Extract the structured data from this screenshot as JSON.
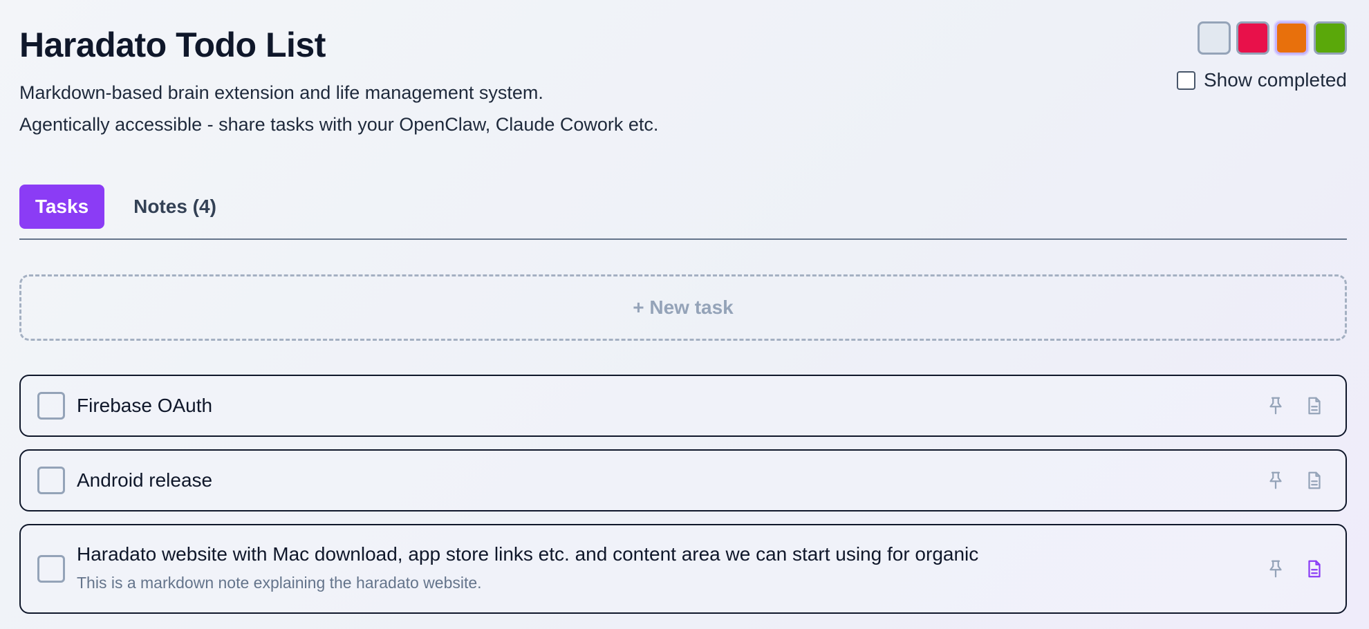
{
  "header": {
    "title": "Haradato Todo List",
    "subtitle_line1": "Markdown-based brain extension and life management system.",
    "subtitle_line2": "Agentically accessible - share tasks with your OpenClaw, Claude Cowork etc."
  },
  "theme_swatches": [
    {
      "name": "light",
      "color": "#e2e8f0",
      "active": false
    },
    {
      "name": "red",
      "color": "#e8114a",
      "active": false
    },
    {
      "name": "orange",
      "color": "#e8700c",
      "active": true
    },
    {
      "name": "green",
      "color": "#5aa80a",
      "active": false
    }
  ],
  "show_completed": {
    "label": "Show completed",
    "checked": false
  },
  "tabs": [
    {
      "label": "Tasks",
      "active": true
    },
    {
      "label": "Notes (4)",
      "active": false
    }
  ],
  "new_task": {
    "label": "+ New task"
  },
  "tasks": [
    {
      "title": "Firebase OAuth",
      "note": "",
      "has_note": false
    },
    {
      "title": "Android release",
      "note": "",
      "has_note": false
    },
    {
      "title": "Haradato website with Mac download, app store links etc. and content area we can start using for organic",
      "note": "This is a markdown note explaining the haradato website.",
      "has_note": true
    }
  ],
  "colors": {
    "accent": "#8b3cf5",
    "icon_muted": "#94a3b8",
    "icon_active": "#8b3cf5"
  },
  "icons": {
    "pin": "pin-icon",
    "document": "document-icon"
  }
}
